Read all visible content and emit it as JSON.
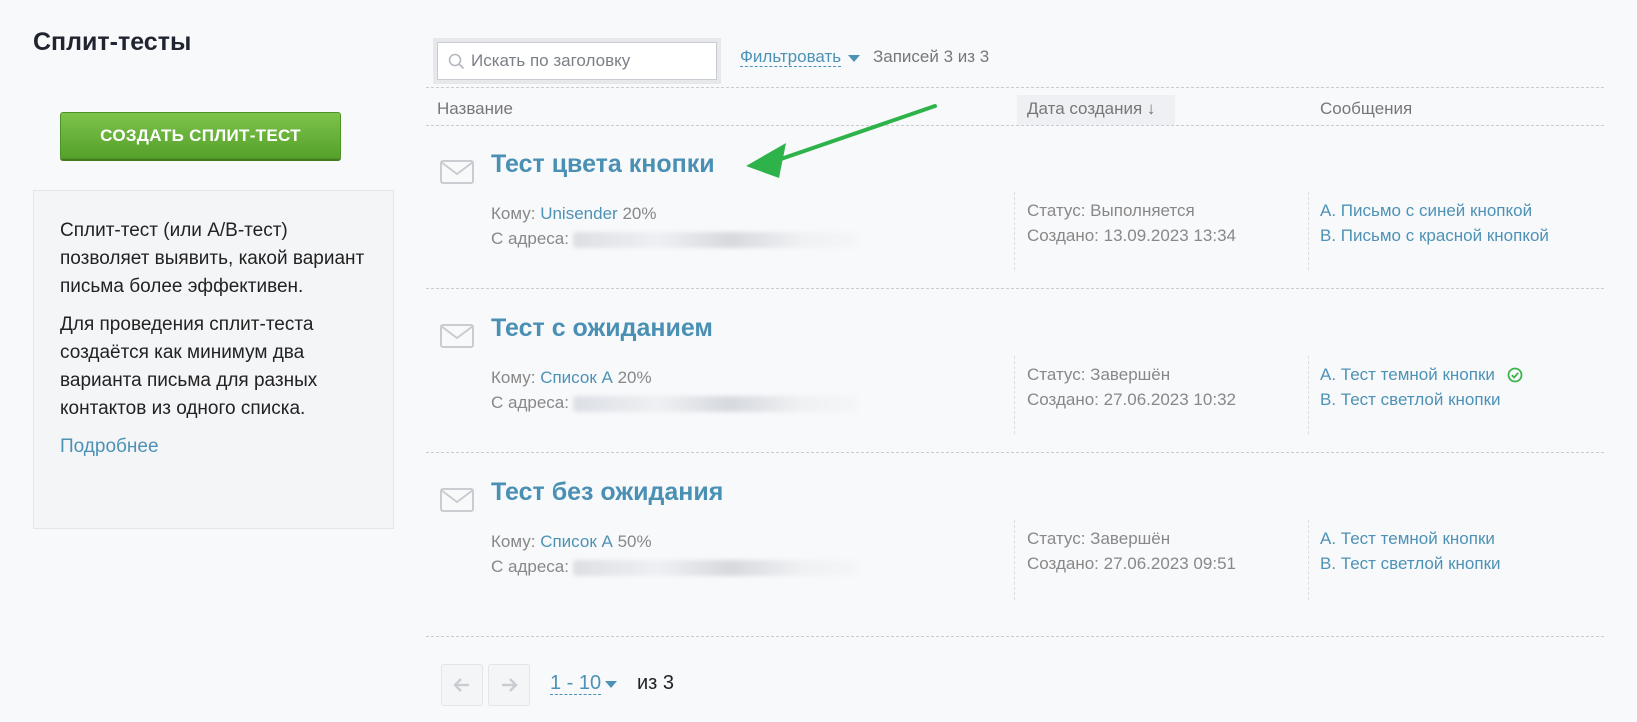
{
  "page": {
    "title": "Сплит-тесты",
    "create_button": "СОЗДАТЬ СПЛИТ-ТЕСТ"
  },
  "info": {
    "paragraph1": "Сплит-тест (или A/B-тест) позволяет выявить, какой вариант письма более эффективен.",
    "paragraph2": "Для проведения сплит-теста создаётся как минимум два варианта письма для разных контактов из одного списка.",
    "more_link": "Подробнее"
  },
  "toolbar": {
    "search_placeholder": "Искать по заголовку",
    "filter_label": "Фильтровать",
    "records_text": "Записей 3 из 3"
  },
  "columns": {
    "name": "Название",
    "date": "Дата создания ↓",
    "messages": "Сообщения"
  },
  "labels": {
    "to": "Кому:",
    "from": "С адреса:"
  },
  "rows": [
    {
      "title": "Тест цвета кнопки",
      "list": "Unisender",
      "percent": "20%",
      "status": "Статус: Выполняется",
      "created": "Создано: 13.09.2023 13:34",
      "msg_a": "A. Письмо с синей кнопкой",
      "msg_b": "B. Письмо с красной кнопкой"
    },
    {
      "title": "Тест с ожиданием",
      "list": "Список А",
      "percent": "20%",
      "status": "Статус: Завершён",
      "created": "Создано: 27.06.2023 10:32",
      "msg_a": "A. Тест темной кнопки",
      "msg_b": "B. Тест светлой кнопки"
    },
    {
      "title": "Тест без ожидания",
      "list": "Список А",
      "percent": "50%",
      "status": "Статус: Завершён",
      "created": "Создано: 27.06.2023 09:51",
      "msg_a": "A. Тест темной кнопки",
      "msg_b": "B. Тест светлой кнопки"
    }
  ],
  "pagination": {
    "range": "1 - 10",
    "total": "из 3"
  },
  "colors": {
    "accent": "#4d92b6",
    "button_green": "#5eaa31",
    "annotation_arrow": "#2db34a"
  }
}
